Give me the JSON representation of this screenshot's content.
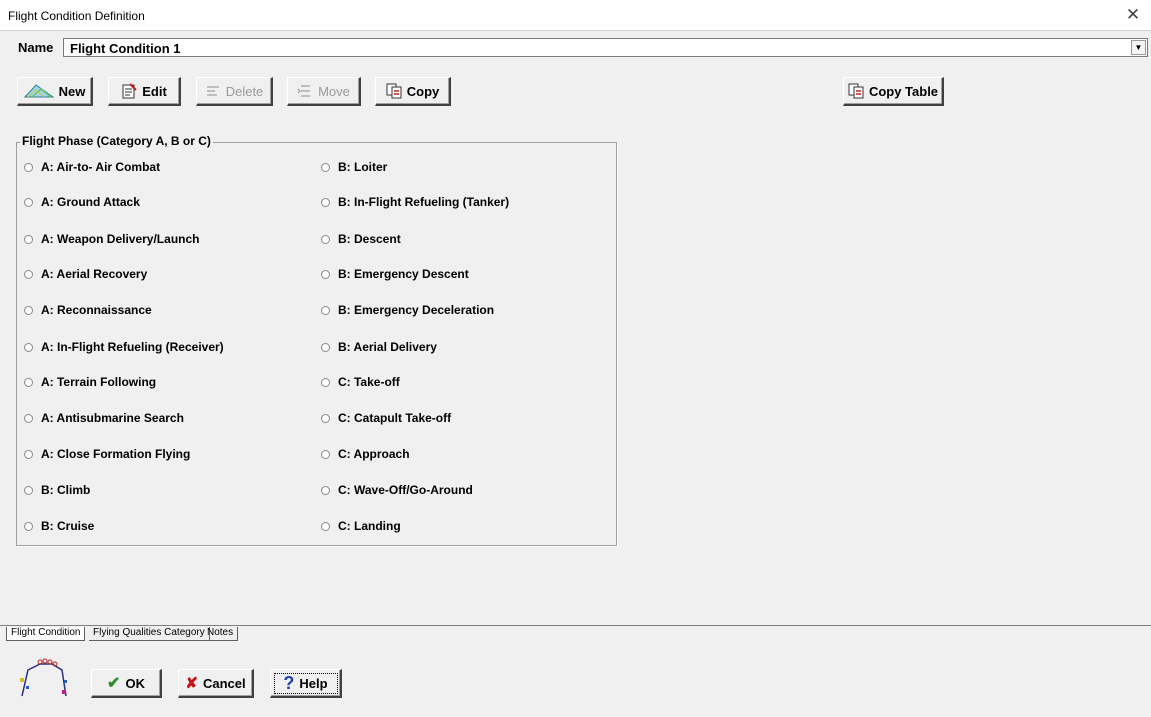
{
  "window": {
    "title": "Flight Condition Definition",
    "close_glyph": "✕"
  },
  "name_field": {
    "label": "Name",
    "value": "Flight Condition 1",
    "arrow": "▼"
  },
  "toolbar": {
    "new_label": "New",
    "edit_label": "Edit",
    "delete_label": "Delete",
    "move_label": "Move",
    "copy_label": "Copy",
    "copy_table_label": "Copy Table"
  },
  "flight_phase": {
    "legend": "Flight Phase (Category A, B or C)",
    "left_column": [
      "A: Air-to- Air Combat",
      "A: Ground Attack",
      "A: Weapon Delivery/Launch",
      "A: Aerial Recovery",
      "A: Reconnaissance",
      "A: In-Flight Refueling (Receiver)",
      "A: Terrain Following",
      "A: Antisubmarine Search",
      "A: Close Formation Flying",
      "B: Climb",
      "B: Cruise"
    ],
    "right_column": [
      "B: Loiter",
      "B: In-Flight Refueling (Tanker)",
      "B: Descent",
      "B: Emergency Descent",
      "B: Emergency Deceleration",
      "B: Aerial Delivery",
      "C: Take-off",
      "C: Catapult Take-off",
      "C: Approach",
      "C: Wave-Off/Go-Around",
      "C: Landing"
    ]
  },
  "tabs": [
    "Flight Condition",
    "Flying Qualities Category",
    "Notes"
  ],
  "dialog_buttons": {
    "ok_label": "OK",
    "cancel_label": "Cancel",
    "help_label": "Help",
    "ok_glyph": "✔",
    "cancel_glyph": "✘",
    "help_glyph": "?"
  },
  "icons": {
    "new": "new-icon",
    "edit": "edit-icon",
    "delete": "delete-icon",
    "move": "move-icon",
    "copy": "copy-icon",
    "app": "flight-profile-icon"
  },
  "colors": {
    "ok_check": "#2e8b2e",
    "cancel_x": "#c81414",
    "help_q": "#1a3fb0"
  }
}
